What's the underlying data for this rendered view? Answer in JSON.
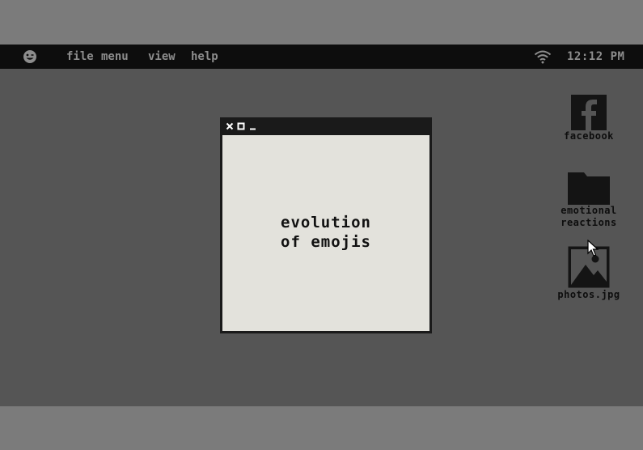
{
  "menubar": {
    "logo_icon": "smiley-face-icon",
    "items": [
      {
        "label": "file"
      },
      {
        "label": "menu"
      },
      {
        "label": "view"
      },
      {
        "label": "help"
      }
    ],
    "status_icon": "wifi-icon",
    "clock": "12:12 PM"
  },
  "window": {
    "controls": [
      "close-icon",
      "maximize-icon",
      "minimize-icon"
    ],
    "text_lines": [
      "evolution",
      "of emojis"
    ]
  },
  "desktop_icons": [
    {
      "label": "facebook",
      "icon": "facebook-icon"
    },
    {
      "label_lines": [
        "emotional",
        "reactions"
      ],
      "icon": "folder-icon"
    },
    {
      "label": "photos.jpg",
      "icon": "image-file-icon"
    }
  ],
  "colors": {
    "desktop": "#555555",
    "menubar": "#0d0d0d",
    "menu_text": "#8d8d8d",
    "window_body": "#e3e2dc",
    "outer_frame": "#7b7b7b"
  }
}
